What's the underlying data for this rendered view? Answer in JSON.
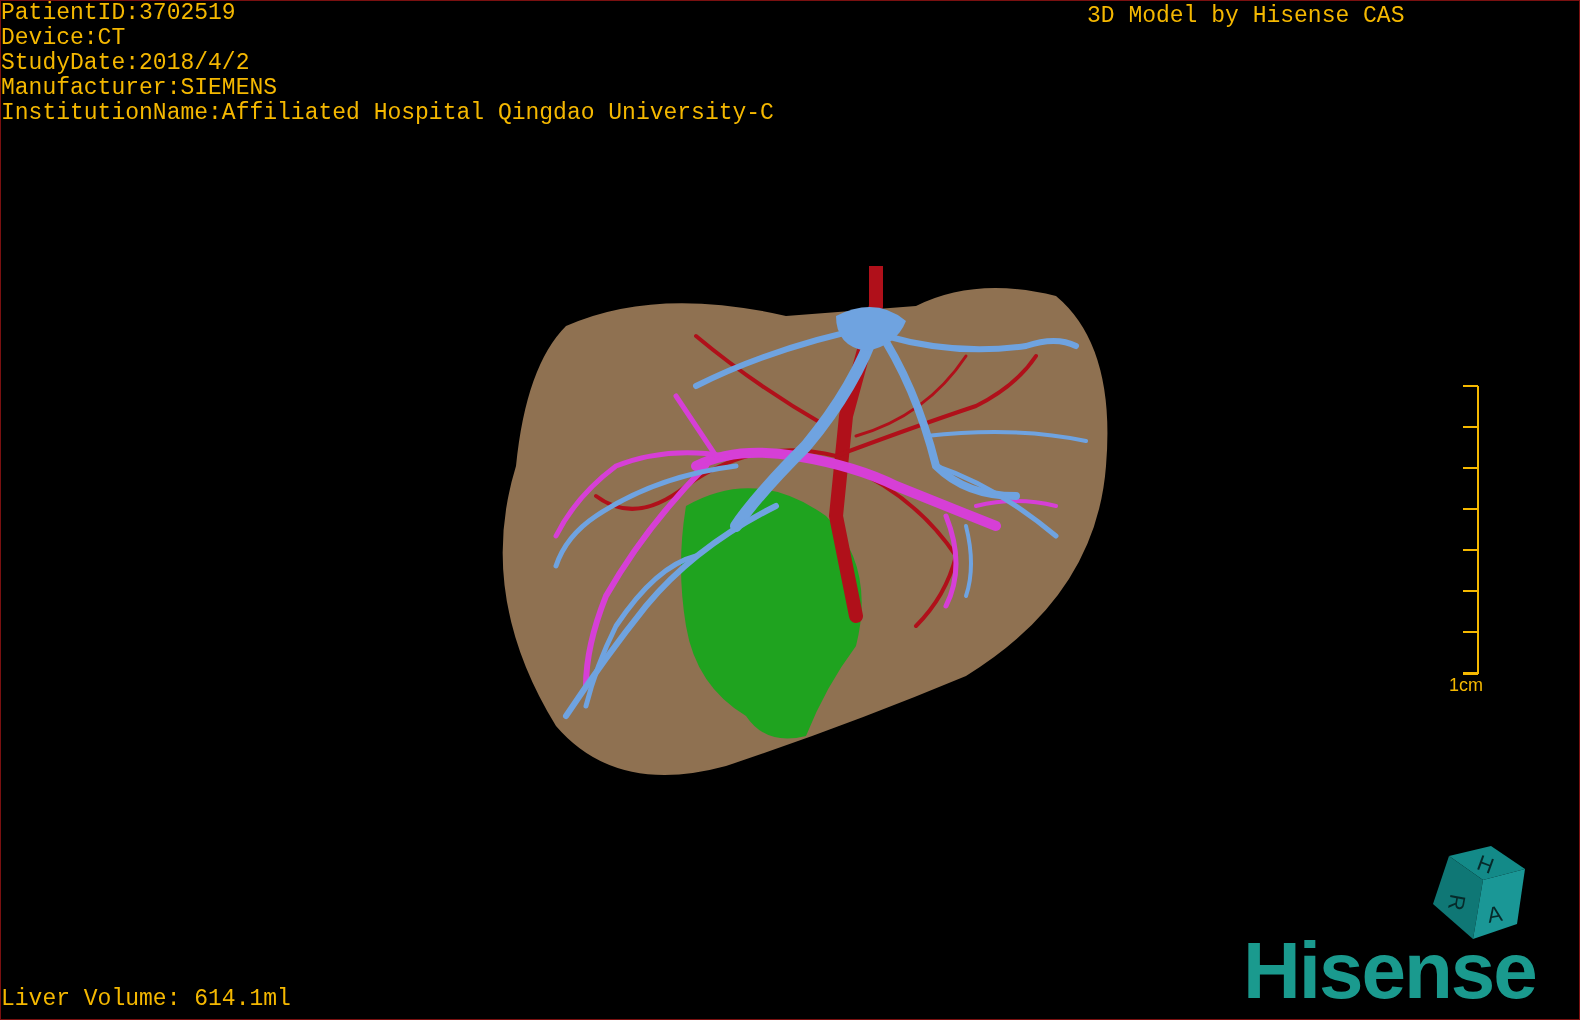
{
  "study_info": [
    "PatientID:3702519",
    "Device:CT",
    "StudyDate:2018/4/2",
    "Manufacturer:SIEMENS",
    "InstitutionName:Affiliated Hospital Qingdao University-C"
  ],
  "title": "3D Model by Hisense CAS",
  "scale_bar": {
    "label": "1cm"
  },
  "orientation_cube": {
    "labels": [
      "H",
      "R",
      "A"
    ]
  },
  "logo": "Hisense",
  "liver_volume": "Liver Volume: 614.1ml"
}
